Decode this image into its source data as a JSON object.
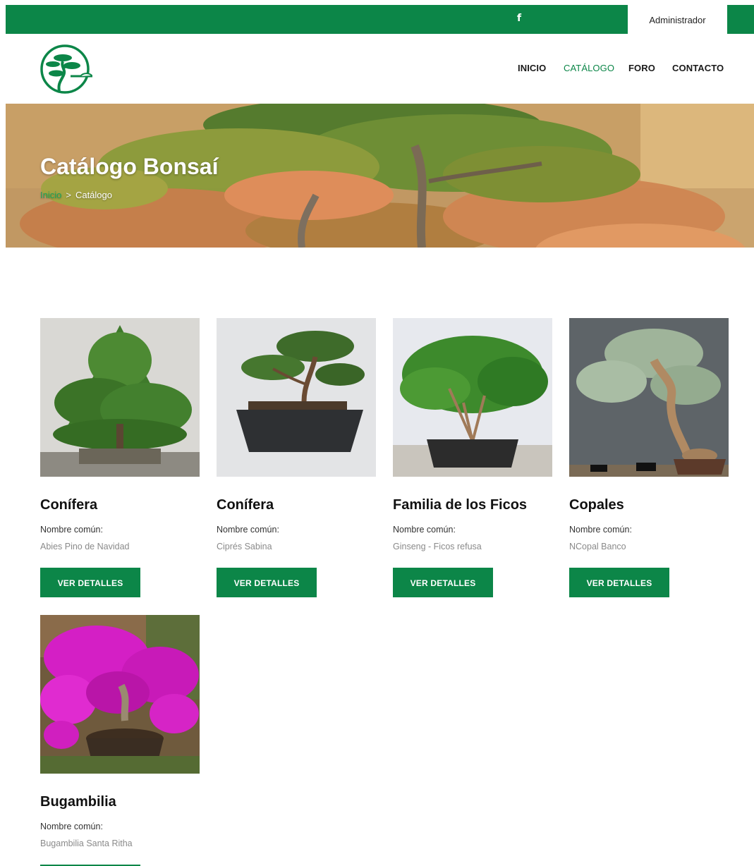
{
  "topbar": {
    "social_icon": "facebook-icon",
    "facebook_glyph": "f",
    "account_label": "Administrador"
  },
  "brand": {
    "logo_icon": "bonsai-logo-icon"
  },
  "nav": {
    "items": [
      {
        "label": "INICIO",
        "active": false
      },
      {
        "label": "CATÁLOGO",
        "active": true
      },
      {
        "label": "FORO",
        "active": false
      },
      {
        "label": "CONTACTO",
        "active": false
      }
    ]
  },
  "hero": {
    "title": "Catálogo Bonsaí",
    "breadcrumb": {
      "home": "Inicio",
      "separator": ">",
      "current": "Catálogo"
    }
  },
  "catalog": {
    "common_name_label": "Nombre común:",
    "button_label": "VER DETALLES",
    "items": [
      {
        "title": "Conífera",
        "common_name": "Abies Pino de Navidad",
        "image": "pine-bonsai-photo"
      },
      {
        "title": "Conífera",
        "common_name": "Ciprés Sabina",
        "image": "juniper-bonsai-photo"
      },
      {
        "title": "Familia de los Ficos",
        "common_name": "Ginseng - Ficos refusa",
        "image": "ficus-bonsai-photo"
      },
      {
        "title": "Copales",
        "common_name": "NCopal Banco",
        "image": "copal-bonsai-photo"
      },
      {
        "title": "Bugambilia",
        "common_name": "Bugambilia Santa Ritha",
        "image": "bougainvillea-bonsai-photo"
      }
    ]
  },
  "colors": {
    "brand_green": "#0c8648",
    "breadcrumb_link": "#1ea45a",
    "text_muted": "#8a8a8a"
  }
}
